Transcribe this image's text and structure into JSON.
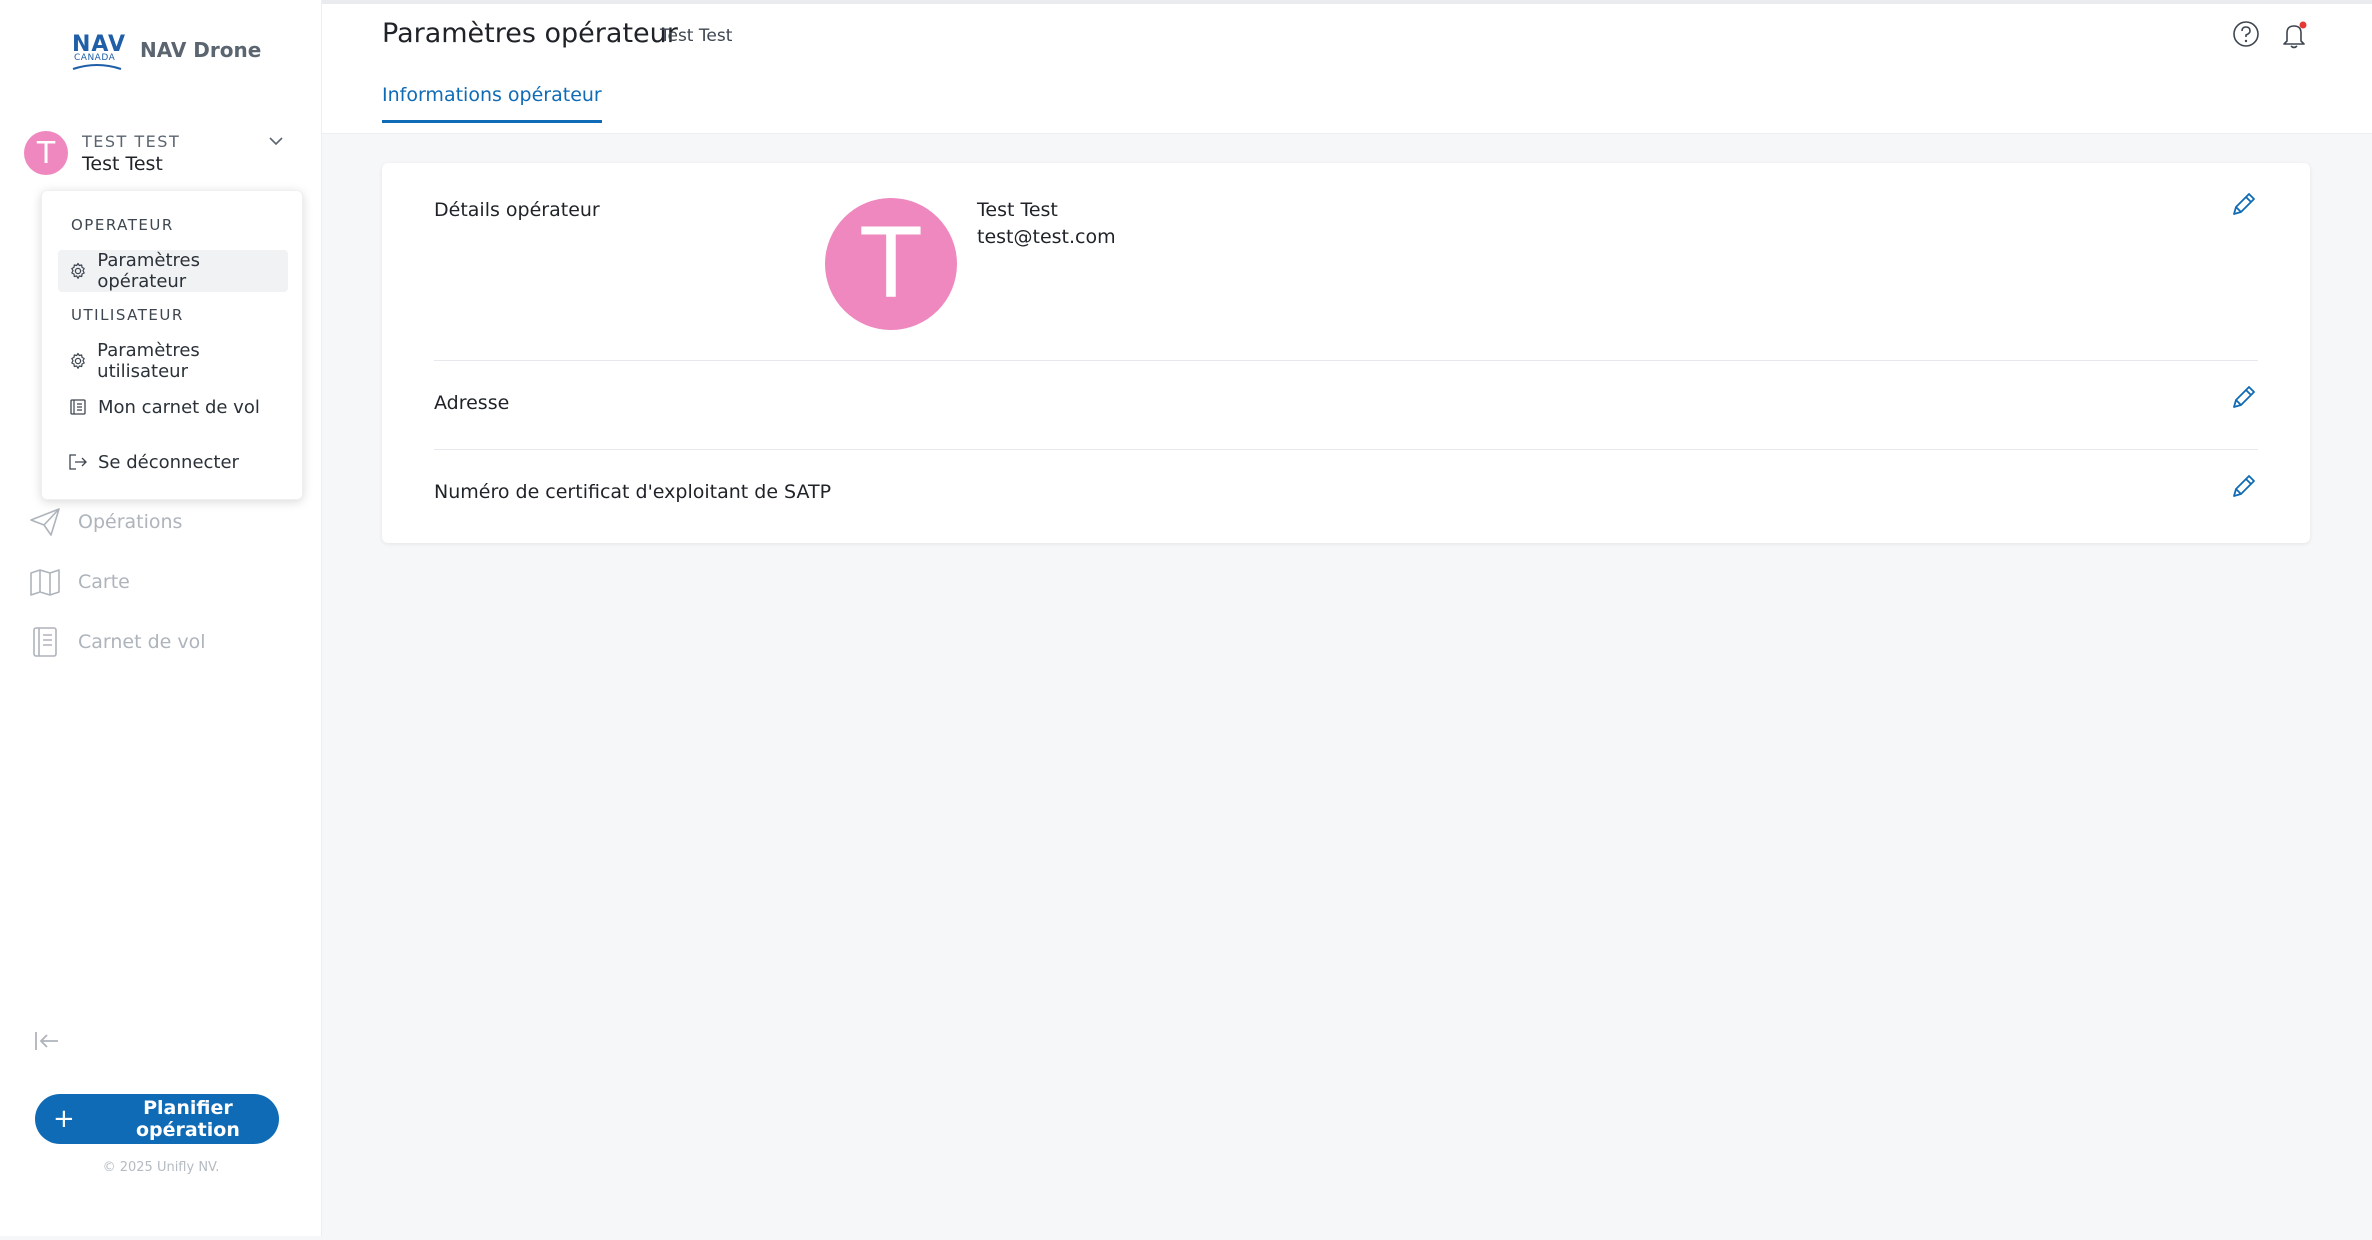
{
  "app": {
    "brand_nav": "NAV",
    "brand_canada": "CANADA",
    "name": "NAV Drone",
    "copyright": "© 2025 Unifly NV."
  },
  "user": {
    "initial": "T",
    "org": "TEST TEST",
    "name": "Test Test"
  },
  "dropdown": {
    "section_operator": "OPERATEUR",
    "operator_settings": "Paramètres opérateur",
    "section_user": "UTILISATEUR",
    "user_settings": "Paramètres utilisateur",
    "logbook": "Mon carnet de vol",
    "logout": "Se déconnecter"
  },
  "nav": {
    "items": [
      {
        "label": "Opérations",
        "icon": "paper-plane-icon"
      },
      {
        "label": "Carte",
        "icon": "map-icon"
      },
      {
        "label": "Carnet de vol",
        "icon": "logbook-icon"
      }
    ]
  },
  "actions": {
    "plan_operation": "Planifier opération"
  },
  "header": {
    "title": "Paramètres opérateur",
    "subtitle": "Test Test",
    "tab": "Informations opérateur"
  },
  "card": {
    "details_label": "Détails opérateur",
    "avatar_initial": "T",
    "operator_name": "Test Test",
    "operator_email": "test@test.com",
    "address_label": "Adresse",
    "certificate_label": "Numéro de certificat d'exploitant de SATP"
  },
  "colors": {
    "accent": "#0f6bb5",
    "avatar": "#ee88bf",
    "notification_dot": "#e53935"
  }
}
